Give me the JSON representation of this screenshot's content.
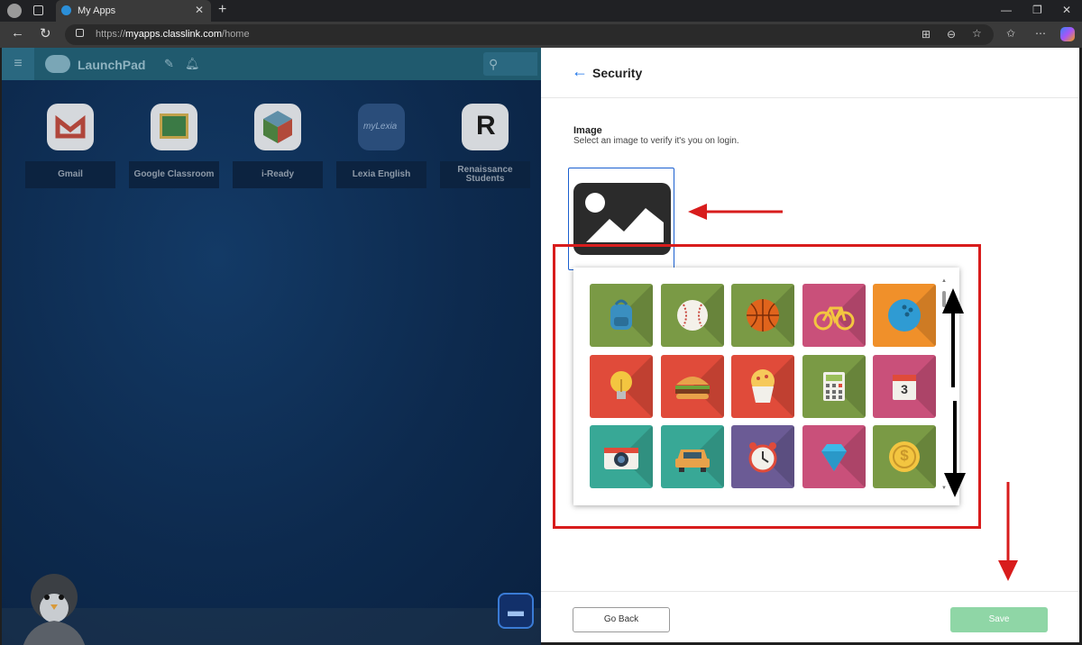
{
  "browser": {
    "tab_title": "My Apps",
    "tab_close": "✕",
    "new_tab": "+",
    "url_prefix": "https://",
    "url_host": "myapps.classlink.com",
    "url_path": "/home",
    "window_controls": [
      "—",
      "❐",
      "✕"
    ]
  },
  "launchpad": {
    "title": "LaunchPad",
    "apps": [
      {
        "label": "Gmail",
        "icon": "gmail-icon"
      },
      {
        "label": "Google Classroom",
        "icon": "google-classroom-icon"
      },
      {
        "label": "i-Ready",
        "icon": "i-ready-icon"
      },
      {
        "label": "Lexia English",
        "icon": "lexia-icon",
        "icon_text": "myLexia"
      },
      {
        "label": "Renaissance Students",
        "icon": "renaissance-icon"
      }
    ]
  },
  "panel": {
    "title": "Security",
    "image_label": "Image",
    "image_desc": "Select an image to verify it's you on login.",
    "go_back": "Go Back",
    "save": "Save"
  },
  "image_options": [
    {
      "name": "backpack",
      "color": "#7a9a45"
    },
    {
      "name": "baseball",
      "color": "#7a9a45"
    },
    {
      "name": "basketball",
      "color": "#7a9a45"
    },
    {
      "name": "bicycle",
      "color": "#c9507a"
    },
    {
      "name": "bowling-ball",
      "color": "#f0902a"
    },
    {
      "name": "lightbulb",
      "color": "#e04b3a"
    },
    {
      "name": "hamburger",
      "color": "#e04b3a"
    },
    {
      "name": "muffin",
      "color": "#e04b3a"
    },
    {
      "name": "calculator",
      "color": "#7a9a45"
    },
    {
      "name": "calendar",
      "color": "#c9507a",
      "text": "3"
    },
    {
      "name": "camera",
      "color": "#38a896"
    },
    {
      "name": "car",
      "color": "#38a896"
    },
    {
      "name": "alarm-clock",
      "color": "#6b5b95"
    },
    {
      "name": "diamond",
      "color": "#c9507a"
    },
    {
      "name": "coin",
      "color": "#7a9a45",
      "text": "$"
    }
  ],
  "colors": {
    "accent": "#1a73e8",
    "save_button": "#8fd6a6",
    "annotation": "#d81c1c"
  }
}
